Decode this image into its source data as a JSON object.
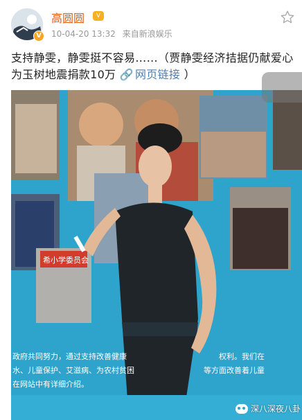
{
  "post": {
    "author": "高圆圆",
    "vip_badge": "V",
    "date": "10-04-20 13:32",
    "source": "来自新浪娱乐",
    "text": "支持静雯，静雯挺不容易……（贾静雯经济拮据仍献爱心 为玉树地震捐款10万",
    "link_icon": "link-icon",
    "link_label": "网页链接",
    "text_end": "）"
  },
  "photo": {
    "sign_text_line1": "政府共同努力，通过支持改善健康",
    "sign_text_line2": "水、儿童保护、艾滋病、为农村贫困",
    "sign_text_line3": "在网站中有详细介绍。",
    "sign_text_right1": "权利。我们在",
    "sign_text_right2": "等方面改善着儿童",
    "red_sign_text": "希小学委员会"
  },
  "watermark": {
    "text": "深八深夜八卦"
  },
  "colors": {
    "author": "#e8590c",
    "link": "#4f7db3",
    "backdrop": "#2ea3cc"
  }
}
